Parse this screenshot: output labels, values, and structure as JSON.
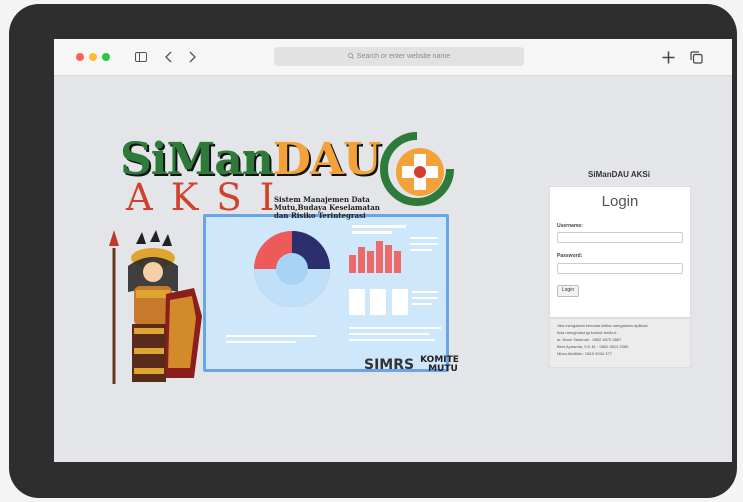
{
  "browser": {
    "search_placeholder": "Search or enter website name",
    "icons": [
      "sidebar-icon",
      "chevron-left-icon",
      "chevron-right-icon",
      "search-icon",
      "plus-icon",
      "tabs-icon"
    ],
    "traffic_lights": [
      "#ff5f57",
      "#febc2e",
      "#28c840"
    ]
  },
  "banner": {
    "title_part_a": "SiMan",
    "title_part_b": "DAU",
    "title_line2": "AKSI",
    "subtitle_line1": "Sistem Manajemen Data",
    "subtitle_line2": "Mutu,Budaya Keselamatan",
    "subtitle_line3": "dan Risiko Terintegrasi",
    "simrs_label": "SIMRS",
    "komite_line1": "KOMITE",
    "komite_line2": "MUTU",
    "colors": {
      "green": "#2d7a3a",
      "orange": "#f3a23a",
      "red": "#d2412c",
      "board": "#cfe7fa"
    }
  },
  "login": {
    "app_name": "SiManDAU AKSi",
    "title": "Login",
    "username_label": "Username:",
    "username_value": "",
    "password_label": "Password:",
    "password_value": "",
    "button": "Login"
  },
  "contact": {
    "lines": [
      "Jika mengalami kendala ketika mengakses aplikasi",
      "bisa menghubungi kontak berikut:",
      "dr. Nurul Salamah : 0852 4670 3867",
      "Beni Aprianda, S.K.M. : 0852 5514 2080",
      "Mirza Abdillah : 0819 5034 377"
    ]
  }
}
